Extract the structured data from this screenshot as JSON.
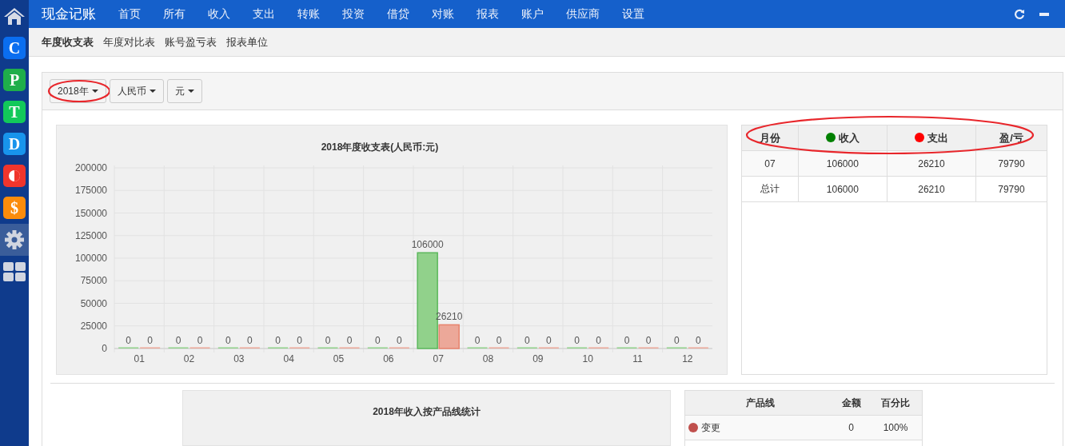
{
  "sidebar": {
    "items": [
      {
        "kind": "home",
        "selected": false
      },
      {
        "kind": "letter",
        "letter": "C",
        "color": "#0a6ef0",
        "selected": false
      },
      {
        "kind": "letter",
        "letter": "P",
        "color": "#1fae4a",
        "selected": false
      },
      {
        "kind": "letter",
        "letter": "T",
        "color": "#12c95a",
        "selected": false
      },
      {
        "kind": "letter",
        "letter": "D",
        "color": "#1894ec",
        "selected": false
      },
      {
        "kind": "halfcircle",
        "color": "#f0352c",
        "selected": false
      },
      {
        "kind": "letter",
        "letter": "$",
        "color": "#fb8c0c",
        "selected": false
      },
      {
        "kind": "gear",
        "selected": true
      },
      {
        "kind": "grid",
        "selected": false
      }
    ]
  },
  "navbar": {
    "brand": "现金记账",
    "items": [
      {
        "label": "首页"
      },
      {
        "label": "所有"
      },
      {
        "label": "收入"
      },
      {
        "label": "支出"
      },
      {
        "label": "转账"
      },
      {
        "label": "投资"
      },
      {
        "label": "借贷"
      },
      {
        "label": "对账"
      },
      {
        "label": "报表"
      },
      {
        "label": "账户"
      },
      {
        "label": "供应商"
      },
      {
        "label": "设置"
      }
    ]
  },
  "subnav": {
    "items": [
      {
        "label": "年度收支表",
        "selected": true
      },
      {
        "label": "年度对比表",
        "selected": false
      },
      {
        "label": "账号盈亏表",
        "selected": false
      },
      {
        "label": "报表单位",
        "selected": false
      }
    ]
  },
  "filters": [
    {
      "label": "2018年",
      "highlighted": true
    },
    {
      "label": "人民币",
      "highlighted": false
    },
    {
      "label": "元",
      "highlighted": false
    }
  ],
  "yearly_chart": {
    "chart_data": {
      "type": "bar",
      "title": "2018年度收支表(人民币:元)",
      "categories": [
        "01",
        "02",
        "03",
        "04",
        "05",
        "06",
        "07",
        "08",
        "09",
        "10",
        "11",
        "12"
      ],
      "series": [
        {
          "color": "#91d18b",
          "values": [
            0,
            0,
            0,
            0,
            0,
            0,
            106000,
            0,
            0,
            0,
            0,
            0
          ]
        },
        {
          "color": "#eca899",
          "values": [
            0,
            0,
            0,
            0,
            0,
            0,
            26210,
            0,
            0,
            0,
            0,
            0
          ]
        }
      ],
      "ylim": [
        0,
        200000
      ],
      "yticks": [
        0,
        25000,
        50000,
        75000,
        100000,
        125000,
        150000,
        175000,
        200000
      ],
      "data_labels": true,
      "grid": true
    }
  },
  "monthly_table": {
    "highlighted": true,
    "columns": [
      {
        "label": "月份"
      },
      {
        "label": "收入",
        "color": "#008000"
      },
      {
        "label": "支出",
        "color": "#ff0000"
      },
      {
        "label": "盈/亏"
      }
    ],
    "rows": [
      [
        "07",
        "106000",
        "26210",
        "79790"
      ],
      [
        "总计",
        "106000",
        "26210",
        "79790"
      ]
    ]
  },
  "product_chart": {
    "title": "2018年收入按产品线统计"
  },
  "product_table": {
    "columns": [
      "产品线",
      "金额",
      "百分比"
    ],
    "rows": [
      {
        "name": "变更",
        "color": "#c0504d",
        "amount": "0",
        "percent": "100%"
      }
    ]
  }
}
